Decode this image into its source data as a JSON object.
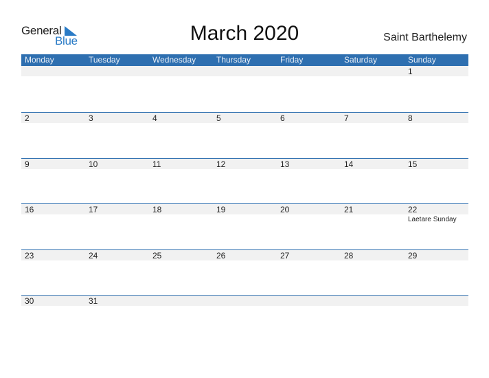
{
  "logo": {
    "part1": "General",
    "part2": "Blue",
    "icon": "triangle-flag-icon",
    "accent": "#2a7bc6"
  },
  "title": "March 2020",
  "country": "Saint Barthelemy",
  "header_color": "#2e6fb0",
  "weekdays": [
    "Monday",
    "Tuesday",
    "Wednesday",
    "Thursday",
    "Friday",
    "Saturday",
    "Sunday"
  ],
  "weeks": [
    {
      "days": [
        "",
        "",
        "",
        "",
        "",
        "",
        "1"
      ],
      "holidays": [
        "",
        "",
        "",
        "",
        "",
        "",
        ""
      ]
    },
    {
      "days": [
        "2",
        "3",
        "4",
        "5",
        "6",
        "7",
        "8"
      ],
      "holidays": [
        "",
        "",
        "",
        "",
        "",
        "",
        ""
      ]
    },
    {
      "days": [
        "9",
        "10",
        "11",
        "12",
        "13",
        "14",
        "15"
      ],
      "holidays": [
        "",
        "",
        "",
        "",
        "",
        "",
        ""
      ]
    },
    {
      "days": [
        "16",
        "17",
        "18",
        "19",
        "20",
        "21",
        "22"
      ],
      "holidays": [
        "",
        "",
        "",
        "",
        "",
        "",
        "Laetare Sunday"
      ]
    },
    {
      "days": [
        "23",
        "24",
        "25",
        "26",
        "27",
        "28",
        "29"
      ],
      "holidays": [
        "",
        "",
        "",
        "",
        "",
        "",
        ""
      ]
    },
    {
      "days": [
        "30",
        "31",
        "",
        "",
        "",
        "",
        ""
      ],
      "holidays": [
        "",
        "",
        "",
        "",
        "",
        "",
        ""
      ]
    }
  ]
}
